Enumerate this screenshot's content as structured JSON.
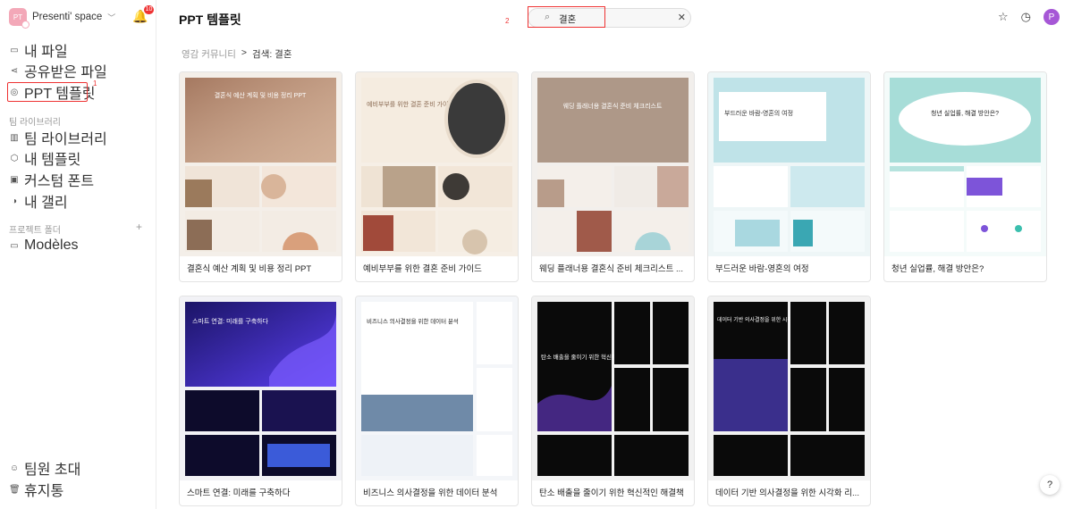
{
  "workspace": {
    "avatar": "PT",
    "name": "Presenti' space",
    "notifications": "10"
  },
  "sidebar": {
    "items": [
      {
        "label": "내 파일",
        "icon": "file-icon"
      },
      {
        "label": "공유받은 파일",
        "icon": "share-icon"
      },
      {
        "label": "PPT 템플릿",
        "icon": "template-icon"
      }
    ],
    "team_title": "팀 라이브러리",
    "team_items": [
      {
        "label": "팀 라이브러리",
        "icon": "library-icon"
      },
      {
        "label": "내 템플릿",
        "icon": "box-icon"
      },
      {
        "label": "커스텀 폰트",
        "icon": "font-icon"
      },
      {
        "label": "내 갤리",
        "icon": "palette-icon"
      }
    ],
    "project_title": "프로젝트 폴더",
    "project_items": [
      {
        "label": "Modèles",
        "icon": "folder-icon"
      }
    ],
    "bottom_items": [
      {
        "label": "팀원 초대",
        "icon": "invite-icon"
      },
      {
        "label": "휴지통",
        "icon": "trash-icon"
      }
    ]
  },
  "annotations": {
    "one": "1",
    "two": "2"
  },
  "header": {
    "title": "PPT 템플릿",
    "search_value": "결혼",
    "avatar": "P"
  },
  "breadcrumb": {
    "root": "영감 커뮤니티",
    "sep": ">",
    "current": "검색: 결혼"
  },
  "cards": [
    {
      "caption": "결혼식 예산 계획 및 비용 정리 PPT",
      "cover": "결혼식 예산 계획 및 비용 정리 PPT"
    },
    {
      "caption": "예비부부를 위한 결혼 준비 가이드",
      "cover": "예비부부를 위한 결혼 준비 가이드"
    },
    {
      "caption": "웨딩 플래너용 결혼식 준비 체크리스트 ...",
      "cover": "웨딩 플래너용 결혼식 준비 체크리스트"
    },
    {
      "caption": "부드러운 바람-영혼의 여정",
      "cover": "부드러운 바람-영혼의 여정"
    },
    {
      "caption": "청년 실업률, 해결 방안은?",
      "cover": "청년 실업률, 해결 방안은?"
    },
    {
      "caption": "스마트 연결: 미래를 구축하다",
      "cover": "스마트 연결: 미래를 구축하다"
    },
    {
      "caption": "비즈니스 의사결정을 위한 데이터 분석",
      "cover": "비즈니스 의사결정을 위한 데이터 분석"
    },
    {
      "caption": "탄소 배출을 줄이기 위한 혁신적인 해결책",
      "cover": "탄소 배출을 줄이기 위한 혁신적인 해결책"
    },
    {
      "caption": "데이터 기반 의사결정을 위한 시각화 리...",
      "cover": "데이터 기반 의사결정을 위한 시각화 리포트"
    }
  ],
  "help": "?"
}
